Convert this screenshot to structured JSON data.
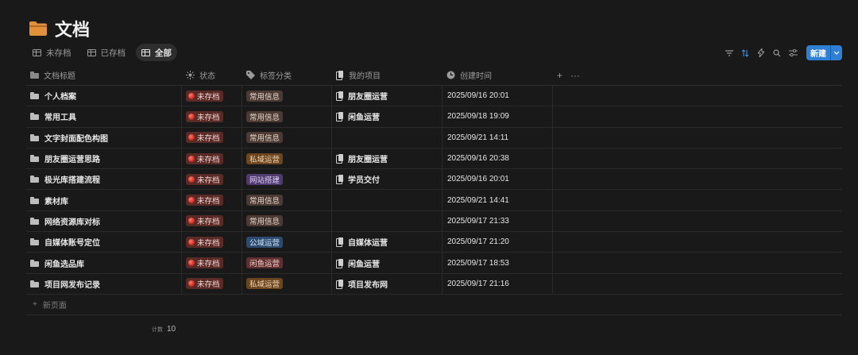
{
  "page": {
    "title": "文档",
    "title_icon": "folder-icon",
    "title_icon_color": "#e0913a"
  },
  "views": [
    {
      "label": "未存档",
      "icon": "table-icon",
      "active": false
    },
    {
      "label": "已存档",
      "icon": "table-icon",
      "active": false
    },
    {
      "label": "全部",
      "icon": "table-icon",
      "active": true
    }
  ],
  "toolbar": {
    "new_label": "新建",
    "accent": "#2f7fd5"
  },
  "columns": [
    {
      "label": "文档标题",
      "icon": "folder-icon"
    },
    {
      "label": "状态",
      "icon": "status-sun-icon"
    },
    {
      "label": "标签分类",
      "icon": "tag-icon"
    },
    {
      "label": "我的项目",
      "icon": "relation-icon"
    },
    {
      "label": "创建时间",
      "icon": "clock-icon"
    }
  ],
  "tag_colors": {
    "常用信息": {
      "bg": "#4a3a33",
      "fg": "#e8d6cc"
    },
    "私域运营": {
      "bg": "#6b4520",
      "fg": "#f2d4b0"
    },
    "网站搭建": {
      "bg": "#4e3a6e",
      "fg": "#e2d3f5"
    },
    "公域运营": {
      "bg": "#2c4a6e",
      "fg": "#cfe0f5"
    },
    "闲鱼运营": {
      "bg": "#5e2f2e",
      "fg": "#f2cdca"
    }
  },
  "rows": [
    {
      "title": "个人档案",
      "status": "未存档",
      "tag": "常用信息",
      "project": "朋友圈运营",
      "created": "2025/09/16 20:01"
    },
    {
      "title": "常用工具",
      "status": "未存档",
      "tag": "常用信息",
      "project": "闲鱼运营",
      "created": "2025/09/18 19:09"
    },
    {
      "title": "文字封面配色构图",
      "status": "未存档",
      "tag": "常用信息",
      "project": "",
      "created": "2025/09/21 14:11"
    },
    {
      "title": "朋友圈运营思路",
      "status": "未存档",
      "tag": "私域运营",
      "project": "朋友圈运营",
      "created": "2025/09/16 20:38"
    },
    {
      "title": "极光库搭建流程",
      "status": "未存档",
      "tag": "网站搭建",
      "project": "学员交付",
      "created": "2025/09/16 20:01"
    },
    {
      "title": "素材库",
      "status": "未存档",
      "tag": "常用信息",
      "project": "",
      "created": "2025/09/21 14:41"
    },
    {
      "title": "网络资源库对标",
      "status": "未存档",
      "tag": "常用信息",
      "project": "",
      "created": "2025/09/17 21:33"
    },
    {
      "title": "自媒体账号定位",
      "status": "未存档",
      "tag": "公域运营",
      "project": "自媒体运营",
      "created": "2025/09/17 21:20"
    },
    {
      "title": "闲鱼选品库",
      "status": "未存档",
      "tag": "闲鱼运营",
      "project": "闲鱼运营",
      "created": "2025/09/17 18:53"
    },
    {
      "title": "项目网发布记录",
      "status": "未存档",
      "tag": "私域运营",
      "project": "项目发布网",
      "created": "2025/09/17 21:16"
    }
  ],
  "new_page_label": "新页面",
  "footer": {
    "count_label": "计数",
    "count_value": "10"
  }
}
